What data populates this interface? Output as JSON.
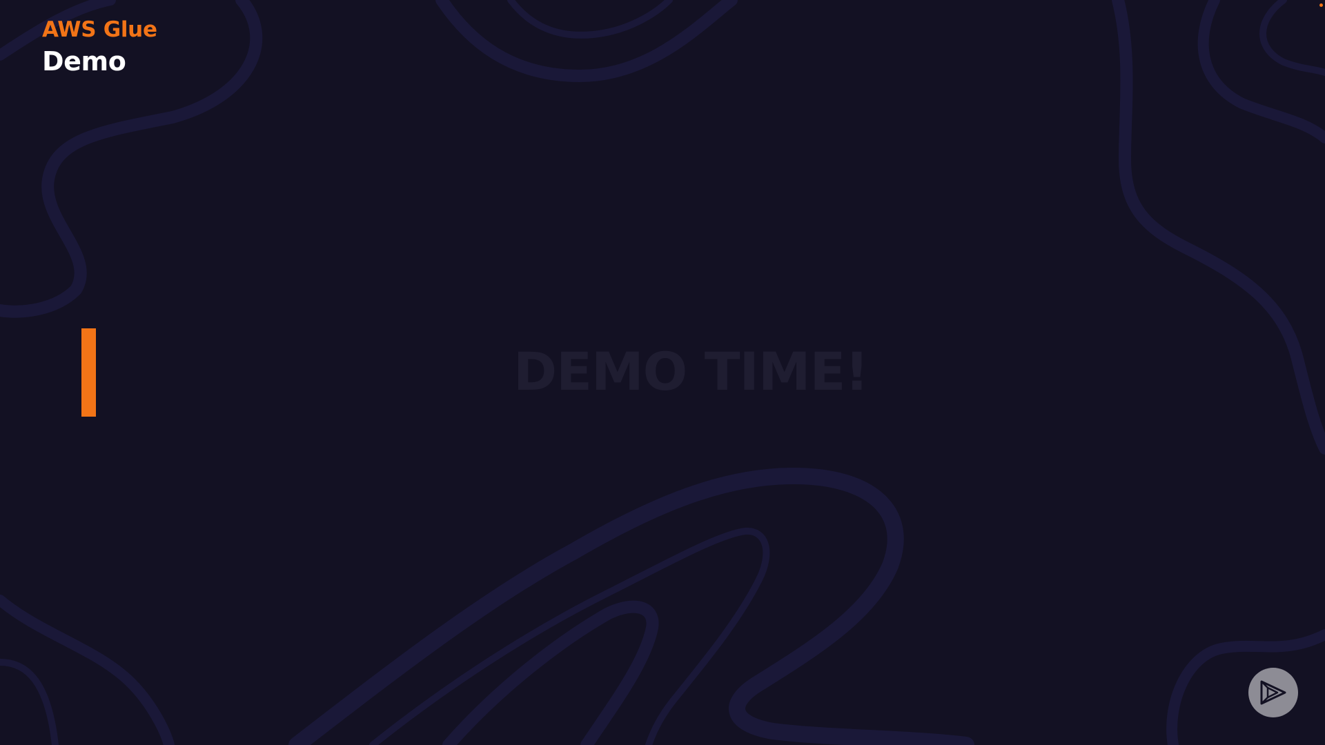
{
  "header": {
    "course_title": "AWS Glue",
    "module_title": "Demo"
  },
  "main": {
    "demo_text": "DEMO TIME!"
  },
  "icons": {
    "logo": "play-logo-icon",
    "accent": "orange-accent-bar"
  },
  "colors": {
    "background": "#131123",
    "accent": "#f27417",
    "title": "#ffffff",
    "watermark_text": "#1f1d31",
    "logo_circle": "#8d8c95"
  }
}
